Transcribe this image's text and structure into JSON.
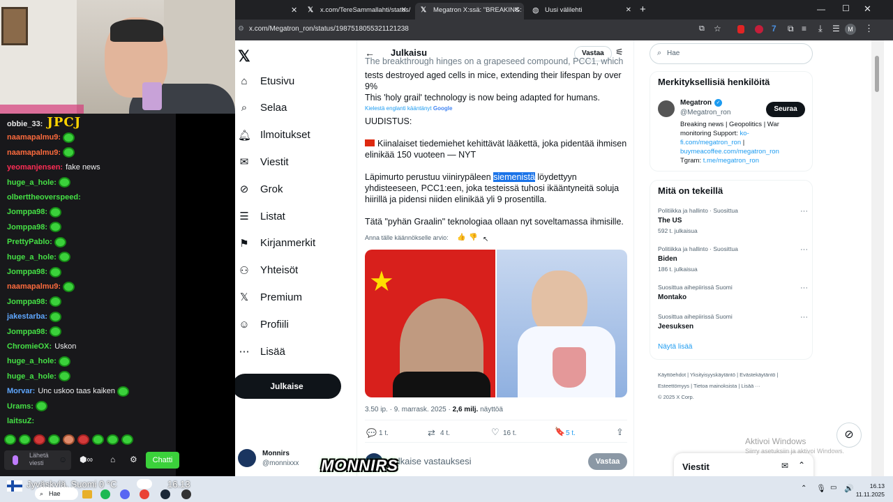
{
  "webcam": {
    "overlay": "JPCJ"
  },
  "chat": {
    "messages": [
      {
        "user": "obbie_33:",
        "color": "#e8e8e8",
        "text": "",
        "emote": false,
        "big": "JPCJ"
      },
      {
        "user": "naamapalmu9:",
        "color": "#ff6b3d",
        "text": "",
        "emote": true
      },
      {
        "user": "naamapalmu9:",
        "color": "#ff6b3d",
        "text": "",
        "emote": true
      },
      {
        "user": "yeomanjensen:",
        "color": "#ff2d55",
        "text": "fake news",
        "emote": false
      },
      {
        "user": "huge_a_hole:",
        "color": "#45e045",
        "text": "",
        "emote": true
      },
      {
        "user": "olberttheoverspeed:",
        "color": "#45e045",
        "text": "",
        "emote": false
      },
      {
        "user": "Jomppa98:",
        "color": "#45e045",
        "text": "",
        "emote": true
      },
      {
        "user": "Jomppa98:",
        "color": "#45e045",
        "text": "",
        "emote": true
      },
      {
        "user": "PrettyPablo:",
        "color": "#45e045",
        "text": "",
        "emote": true
      },
      {
        "user": "huge_a_hole:",
        "color": "#45e045",
        "text": "",
        "emote": true
      },
      {
        "user": "Jomppa98:",
        "color": "#45e045",
        "text": "",
        "emote": true
      },
      {
        "user": "naamapalmu9:",
        "color": "#ff6b3d",
        "text": "",
        "emote": true
      },
      {
        "user": "Jomppa98:",
        "color": "#45e045",
        "text": "",
        "emote": true
      },
      {
        "user": "jakestarba:",
        "color": "#5fa7ff",
        "text": "",
        "emote": true
      },
      {
        "user": "Jomppa98:",
        "color": "#45e045",
        "text": "",
        "emote": true
      },
      {
        "user": "ChromieOX:",
        "color": "#45e045",
        "text": "Uskon",
        "emote": false
      },
      {
        "user": "huge_a_hole:",
        "color": "#45e045",
        "text": "",
        "emote": true
      },
      {
        "user": "huge_a_hole:",
        "color": "#45e045",
        "text": "",
        "emote": true
      },
      {
        "user": "Morvar:",
        "color": "#5fa7ff",
        "text": "Unc uskoo taas kaiken",
        "emote": true
      },
      {
        "user": "Urams:",
        "color": "#45e045",
        "text": "",
        "emote": true
      },
      {
        "user": "laitsuZ:",
        "color": "#45e045",
        "text": "",
        "emote": false
      }
    ],
    "input_placeholder": "Lähetä viesti",
    "chat_button": "Chatti"
  },
  "browser": {
    "tabs": [
      {
        "label": "x.com/TereSammallahti/status/"
      },
      {
        "label": "Megatron X:ssä: \"BREAKING: c"
      },
      {
        "label": "Uusi välilehti"
      }
    ],
    "url": "x.com/Megatron_ron/status/1987518055321121238",
    "profile_initial": "M"
  },
  "x": {
    "nav": [
      {
        "label": "Etusivu",
        "icon": "home-icon"
      },
      {
        "label": "Selaa",
        "icon": "search-icon"
      },
      {
        "label": "Ilmoitukset",
        "icon": "bell-icon"
      },
      {
        "label": "Viestit",
        "icon": "mail-icon"
      },
      {
        "label": "Grok",
        "icon": "grok-icon"
      },
      {
        "label": "Listat",
        "icon": "list-icon"
      },
      {
        "label": "Kirjanmerkit",
        "icon": "bookmark-icon"
      },
      {
        "label": "Yhteisöt",
        "icon": "communities-icon"
      },
      {
        "label": "Premium",
        "icon": "x-logo-icon"
      },
      {
        "label": "Profiili",
        "icon": "profile-icon"
      },
      {
        "label": "Lisää",
        "icon": "more-icon"
      }
    ],
    "post_button": "Julkaise",
    "account": {
      "name": "Monnirs",
      "handle": "@monnixxx"
    },
    "header": {
      "title": "Julkaisu",
      "reply_button": "Vastaa"
    },
    "tweet": {
      "en_line1": "The breakthrough hinges on a grapeseed compound, PCC1, which in",
      "en_line2": "tests destroyed aged cells in mice, extending their lifespan by over 9%",
      "en_line3": "This 'holy grail' technology is now being adapted for humans.",
      "translated_from": "Kielestä englanti kääntänyt",
      "google": "Google",
      "fi_heading": "UUDISTUS:",
      "fi_p1": "Kiinalaiset tiedemiehet kehittävät lääkettä, joka pidentää ihmisen elinikää 150 vuoteen — NYT",
      "fi_p2_before": "Läpimurto perustuu viinirypäleen ",
      "fi_p2_highlight": "siemenistä",
      "fi_p2_after": " löydettyyn yhdisteeseen, PCC1:een, joka testeissä tuhosi ikääntyneitä soluja hiirillä ja pidensi niiden elinikää yli 9 prosentilla.",
      "fi_p3": "Tätä \"pyhän Graalin\" teknologiaa ollaan nyt soveltamassa ihmisille.",
      "rate_prompt": "Anna tälle käännökselle arvio:",
      "timestamp": "3.50 ip. · 9. marrask. 2025 · ",
      "views_count": "2,6 milj.",
      "views_label": " näyttöä",
      "replies": "1 t.",
      "reposts": "4 t.",
      "likes": "16 t.",
      "bookmarks": "5 t."
    },
    "reply_box": {
      "placeholder": "Julkaise vastauksesi",
      "button": "Vastaa"
    },
    "search_placeholder": "Hae",
    "relevant": {
      "title": "Merkityksellisiä henkilöitä",
      "name": "Megatron",
      "handle": "@Megatron_ron",
      "follow": "Seuraa",
      "bio1": "Breaking news | Geopolitics | War monitoring Support: ",
      "link1": "ko-fi.com/megatron_ron",
      "bio_sep": " | ",
      "link2": "buymeacoffee.com/megatron_ron",
      "tgram_label": "Tgram: ",
      "link3": "t.me/megatron_ron"
    },
    "trends": {
      "title": "Mitä on tekeillä",
      "items": [
        {
          "context": "Politiikka ja hallinto · Suosittua",
          "name": "The US",
          "count": "592 t. julkaisua"
        },
        {
          "context": "Politiikka ja hallinto · Suosittua",
          "name": "Biden",
          "count": "186 t. julkaisua"
        },
        {
          "context": "Suosittua aihepiirissä Suomi",
          "name": "Montako",
          "count": ""
        },
        {
          "context": "Suosittua aihepiirissä Suomi",
          "name": "Jeesuksen",
          "count": ""
        }
      ],
      "show_more": "Näytä lisää"
    },
    "footer": {
      "line1": [
        "Käyttöehdot",
        "Yksityisyyskäytäntö",
        "Evästekäytäntö"
      ],
      "line2": [
        "Esteettömyys",
        "Tietoa mainoksista",
        "Lisää ···"
      ],
      "copyright": "© 2025 X Corp."
    },
    "messages_drawer": "Viestit"
  },
  "overlays": {
    "activate_title": "Aktivoi Windows",
    "activate_sub": "Siirry asetuksiin ja aktivoi Windows.",
    "streamer_tag": "MONNIRS"
  },
  "taskbar": {
    "weather": "Jyväskylä, Suomi   0 °C",
    "clock_overlay": "16.13",
    "search": "Hae",
    "time": "16.13",
    "date": "11.11.2025"
  }
}
